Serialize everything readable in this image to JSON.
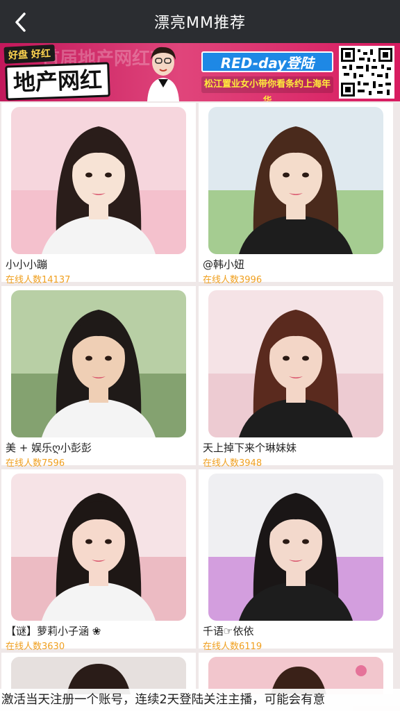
{
  "header": {
    "title": "漂亮MM推荐"
  },
  "banner": {
    "tag": "好盘 好红",
    "main_text": "地产网红",
    "faded_text": "首届地产网红节",
    "red_day": "RED-day登陆",
    "subtext": "松江置业女小带你看条约上海年华",
    "colors": {
      "bg": "#d81b60",
      "accent": "#1e88e5"
    }
  },
  "streamers": [
    {
      "name": "小小小蹦",
      "count_prefix": "在线人数",
      "count": "14137",
      "palette": [
        "#f6d6dd",
        "#f3b8c6",
        "#2a1d1a",
        "#f7e3d5"
      ]
    },
    {
      "name": "@韩小妞",
      "count_prefix": "在线人数",
      "count": "3996",
      "palette": [
        "#dfe9ef",
        "#8bbf6a",
        "#4a2a1c",
        "#f4dccb"
      ]
    },
    {
      "name": "美 + 娱乐ღ小彭彭",
      "count_prefix": "在线人数",
      "count": "7596",
      "palette": [
        "#b8cfa5",
        "#6e8e5a",
        "#1f1a18",
        "#efcfb5"
      ]
    },
    {
      "name": "天上掉下来个琳妹妹",
      "count_prefix": "在线人数",
      "count": "3948",
      "palette": [
        "#f5e3e6",
        "#e9c1c9",
        "#5a2a1e",
        "#f3d6c7"
      ]
    },
    {
      "name": "【谜】萝莉小子涵 ❀",
      "count_prefix": "在线人数",
      "count": "3630",
      "palette": [
        "#f6e3e6",
        "#e8a9b4",
        "#1e1715",
        "#f6d9cc"
      ]
    },
    {
      "name": "千语☞依依",
      "count_prefix": "在线人数",
      "count": "6119",
      "palette": [
        "#efeff2",
        "#c77cd6",
        "#1a1616",
        "#f3d9cc"
      ]
    }
  ],
  "footer": {
    "ticker": "激活当天注册一个账号，连续2天登陆关注主播，可能会有意"
  }
}
